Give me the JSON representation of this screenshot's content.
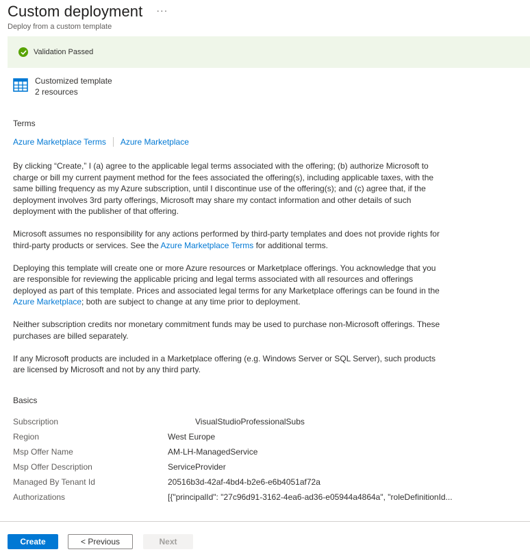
{
  "header": {
    "title": "Custom deployment",
    "more": "···",
    "subtitle": "Deploy from a custom template"
  },
  "validation": {
    "text": "Validation Passed",
    "color": "#57a300"
  },
  "template": {
    "name": "Customized template",
    "resources": "2 resources"
  },
  "terms": {
    "heading": "Terms",
    "links": [
      "Azure Marketplace Terms",
      "Azure Marketplace"
    ],
    "p1": "By clicking “Create,” I (a) agree to the applicable legal terms associated with the offering; (b) authorize Microsoft to charge or bill my current payment method for the fees associated the offering(s), including applicable taxes, with the same billing frequency as my Azure subscription, until I discontinue use of the offering(s); and (c) agree that, if the deployment involves 3rd party offerings, Microsoft may share my contact information and other details of such deployment with the publisher of that offering.",
    "p2_before": "Microsoft assumes no responsibility for any actions performed by third-party templates and does not provide rights for third-party products or services. See the ",
    "p2_link": "Azure Marketplace Terms",
    "p2_after": " for additional terms.",
    "p3_before": "Deploying this template will create one or more Azure resources or Marketplace offerings.  You acknowledge that you are responsible for reviewing the applicable pricing and legal terms associated with all resources and offerings deployed as part of this template.  Prices and associated legal terms for any Marketplace offerings can be found in the ",
    "p3_link": "Azure Marketplace",
    "p3_after": "; both are subject to change at any time prior to deployment.",
    "p4": "Neither subscription credits nor monetary commitment funds may be used to purchase non-Microsoft offerings. These purchases are billed separately.",
    "p5": "If any Microsoft products are included in a Marketplace offering (e.g. Windows Server or SQL Server), such products are licensed by Microsoft and not by any third party."
  },
  "basics": {
    "heading": "Basics",
    "rows": [
      {
        "key": "Subscription",
        "value": "VisualStudioProfessionalSubs"
      },
      {
        "key": "Region",
        "value": "West Europe"
      },
      {
        "key": "Msp Offer Name",
        "value": "AM-LH-ManagedService"
      },
      {
        "key": "Msp Offer Description",
        "value": "ServiceProvider"
      },
      {
        "key": "Managed By Tenant Id",
        "value": "20516b3d-42af-4bd4-b2e6-e6b4051af72a"
      },
      {
        "key": "Authorizations",
        "value": "[{\"principalId\": \"27c96d91-3162-4ea6-ad36-e05944a4864a\", \"roleDefinitionId..."
      }
    ]
  },
  "footer": {
    "create": "Create",
    "previous": "< Previous",
    "next": "Next"
  }
}
